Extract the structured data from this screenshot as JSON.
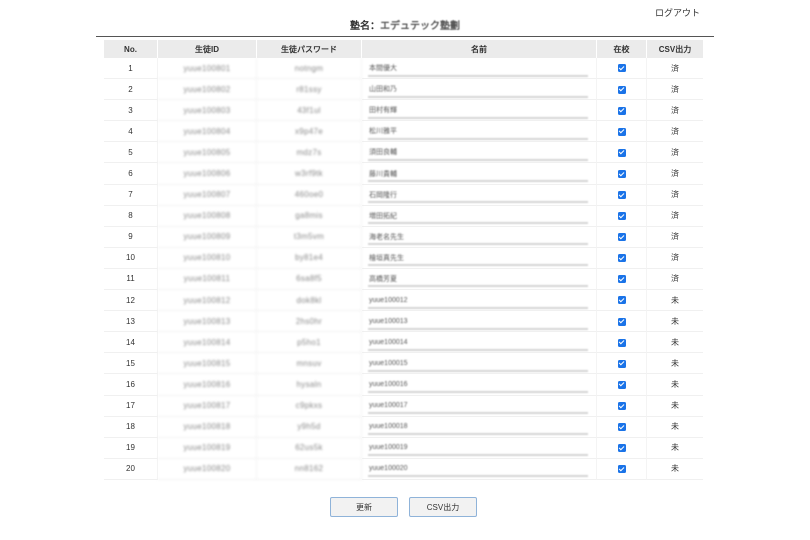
{
  "header": {
    "logout_label": "ログアウト",
    "school_prefix": "塾名：",
    "school_name": "エデュテック塾劃"
  },
  "table": {
    "columns": [
      "No.",
      "生徒ID",
      "生徒パスワード",
      "名前",
      "在校",
      "CSV出力"
    ],
    "rows": [
      {
        "no": "1",
        "id": "yuue100801",
        "pw": "notngm",
        "name": "本間優大",
        "enrolled": true,
        "csv": "済"
      },
      {
        "no": "2",
        "id": "yuue100802",
        "pw": "r81ssy",
        "name": "山田和乃",
        "enrolled": true,
        "csv": "済"
      },
      {
        "no": "3",
        "id": "yuue100803",
        "pw": "43f1ul",
        "name": "田村有輝",
        "enrolled": true,
        "csv": "済"
      },
      {
        "no": "4",
        "id": "yuue100804",
        "pw": "x9p47e",
        "name": "松川雅平",
        "enrolled": true,
        "csv": "済"
      },
      {
        "no": "5",
        "id": "yuue100805",
        "pw": "mdz7s",
        "name": "須田良輔",
        "enrolled": true,
        "csv": "済"
      },
      {
        "no": "6",
        "id": "yuue100806",
        "pw": "w3rf9tk",
        "name": "藤川貴輔",
        "enrolled": true,
        "csv": "済"
      },
      {
        "no": "7",
        "id": "yuue100807",
        "pw": "460oe0",
        "name": "石岡隆行",
        "enrolled": true,
        "csv": "済"
      },
      {
        "no": "8",
        "id": "yuue100808",
        "pw": "ga8mis",
        "name": "増田拓紀",
        "enrolled": true,
        "csv": "済"
      },
      {
        "no": "9",
        "id": "yuue100809",
        "pw": "t3m5vm",
        "name": "海老名先生",
        "enrolled": true,
        "csv": "済"
      },
      {
        "no": "10",
        "id": "yuue100810",
        "pw": "by81e4",
        "name": "檜垣真先生",
        "enrolled": true,
        "csv": "済"
      },
      {
        "no": "11",
        "id": "yuue100811",
        "pw": "6sa8f5",
        "name": "高橋芳夏",
        "enrolled": true,
        "csv": "済"
      },
      {
        "no": "12",
        "id": "yuue100812",
        "pw": "dok8kl",
        "name": "yuue100012",
        "enrolled": true,
        "csv": "未"
      },
      {
        "no": "13",
        "id": "yuue100813",
        "pw": "2hs0hr",
        "name": "yuue100013",
        "enrolled": true,
        "csv": "未"
      },
      {
        "no": "14",
        "id": "yuue100814",
        "pw": "p5ho1",
        "name": "yuue100014",
        "enrolled": true,
        "csv": "未"
      },
      {
        "no": "15",
        "id": "yuue100815",
        "pw": "mnsuv",
        "name": "yuue100015",
        "enrolled": true,
        "csv": "未"
      },
      {
        "no": "16",
        "id": "yuue100816",
        "pw": "hysaln",
        "name": "yuue100016",
        "enrolled": true,
        "csv": "未"
      },
      {
        "no": "17",
        "id": "yuue100817",
        "pw": "c9pkxs",
        "name": "yuue100017",
        "enrolled": true,
        "csv": "未"
      },
      {
        "no": "18",
        "id": "yuue100818",
        "pw": "y9h5d",
        "name": "yuue100018",
        "enrolled": true,
        "csv": "未"
      },
      {
        "no": "19",
        "id": "yuue100819",
        "pw": "62us5k",
        "name": "yuue100019",
        "enrolled": true,
        "csv": "未"
      },
      {
        "no": "20",
        "id": "yuue100820",
        "pw": "nn8162",
        "name": "yuue100020",
        "enrolled": true,
        "csv": "未"
      }
    ]
  },
  "buttons": {
    "update_label": "更新",
    "csv_label": "CSV出力"
  },
  "colors": {
    "checkbox": "#1a73e8",
    "header_bg": "#ebebeb",
    "button_border": "#8fb3d9"
  }
}
